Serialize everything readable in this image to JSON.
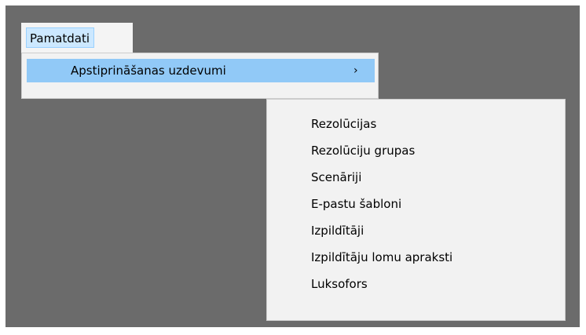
{
  "menubar": {
    "item_label": "Pamatdati"
  },
  "primary_menu": {
    "item_label": "Apstiprināšanas uzdevumi",
    "submenu_arrow": "›"
  },
  "submenu": {
    "items": [
      {
        "label": "Rezolūcijas"
      },
      {
        "label": "Rezolūciju grupas"
      },
      {
        "label": "Scenāriji"
      },
      {
        "label": "E-pastu šabloni"
      },
      {
        "label": "Izpildītāji"
      },
      {
        "label": "Izpildītāju lomu apraksti"
      },
      {
        "label": "Luksofors"
      }
    ]
  },
  "colors": {
    "backdrop": "#6b6b6b",
    "menu_background": "#f2f2f2",
    "highlight": "#91c9f7",
    "menubar_selected": "#cce8ff"
  }
}
